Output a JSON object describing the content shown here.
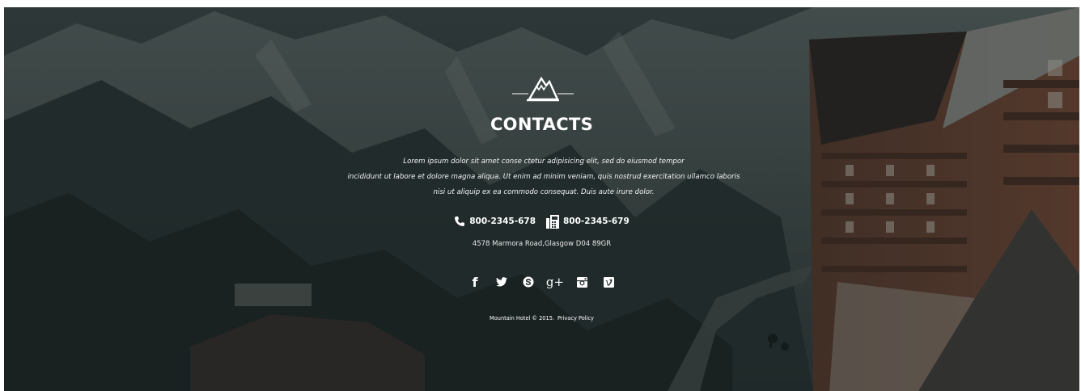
{
  "section": {
    "title": "CONTACTS",
    "description_lines": [
      "Lorem ipsum dolor sit amet conse ctetur adipisicing elit, sed do eiusmod tempor",
      "incididunt ut labore et dolore magna aliqua. Ut enim ad minim veniam, quis nostrud exercitation ullamco laboris",
      "nisi ut aliquip ex ea commodo consequat. Duis aute irure dolor."
    ]
  },
  "contact": {
    "phone": "800-2345-678",
    "fax": "800-2345-679",
    "address": "4578 Marmora Road,Glasgow D04 89GR"
  },
  "social": [
    {
      "name": "facebook",
      "icon": "facebook-icon",
      "glyph": "f"
    },
    {
      "name": "twitter",
      "icon": "twitter-icon"
    },
    {
      "name": "skype",
      "icon": "skype-icon"
    },
    {
      "name": "google-plus",
      "icon": "google-plus-icon",
      "glyph": "g+"
    },
    {
      "name": "instagram",
      "icon": "instagram-icon"
    },
    {
      "name": "vimeo",
      "icon": "vimeo-icon"
    }
  ],
  "footer": {
    "copyright": "Mountain Hotel © 2015.",
    "privacy_label": "Privacy Policy"
  },
  "colors": {
    "text": "#ffffff",
    "overlay": "#1c2626"
  }
}
